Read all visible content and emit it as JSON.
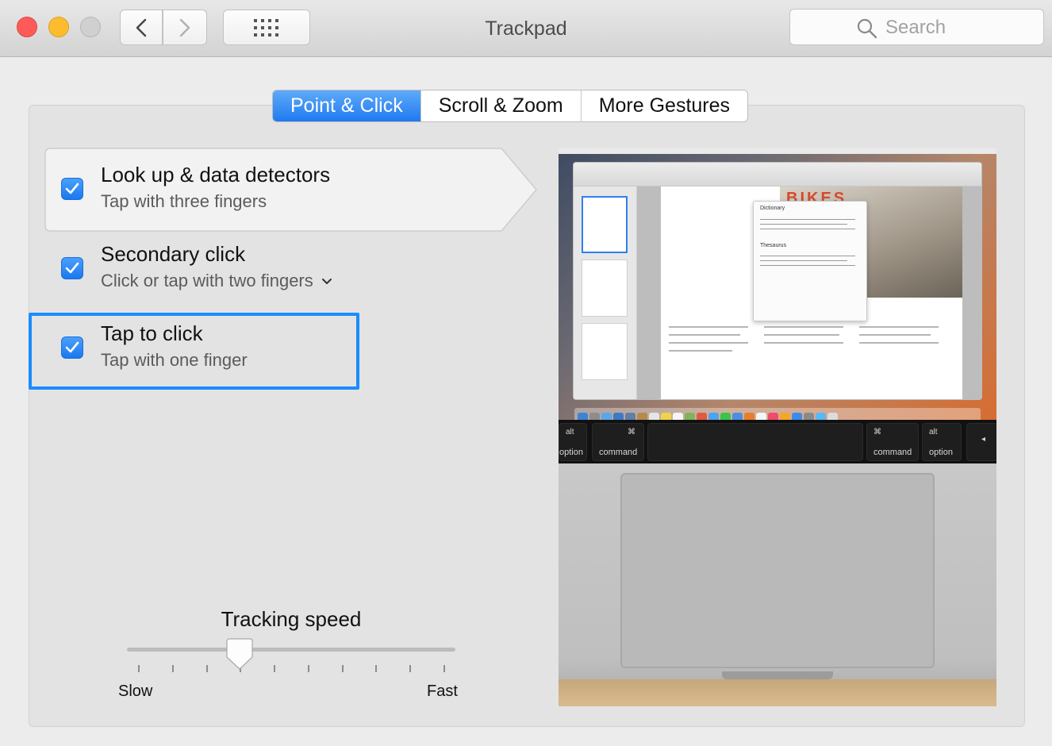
{
  "window": {
    "title": "Trackpad",
    "search_placeholder": "Search"
  },
  "tabs": [
    {
      "label": "Point & Click",
      "active": true
    },
    {
      "label": "Scroll & Zoom",
      "active": false
    },
    {
      "label": "More Gestures",
      "active": false
    }
  ],
  "options": [
    {
      "title": "Look up & data detectors",
      "subtitle": "Tap with three fingers",
      "checked": true
    },
    {
      "title": "Secondary click",
      "subtitle": "Click or tap with two fingers",
      "checked": true,
      "has_dropdown": true
    },
    {
      "title": "Tap to click",
      "subtitle": "Tap with one finger",
      "checked": true,
      "focused": true
    }
  ],
  "tracking": {
    "label": "Tracking speed",
    "min_label": "Slow",
    "max_label": "Fast",
    "ticks": 10,
    "value_step": 3
  },
  "preview": {
    "keys": [
      {
        "top": "alt",
        "bottom": "option"
      },
      {
        "top": "⌘",
        "bottom": "command"
      },
      {
        "top": "⌘",
        "bottom": "command"
      },
      {
        "top": "alt",
        "bottom": "option"
      }
    ],
    "popup": {
      "heading1": "Dictionary",
      "heading2": "Thesaurus"
    },
    "doc_headline": "BIKES"
  },
  "colors": {
    "accent": "#1a7cf2",
    "focus_ring": "#1a8cff",
    "close": "#fc5b57",
    "minimize": "#fdbc2f"
  }
}
